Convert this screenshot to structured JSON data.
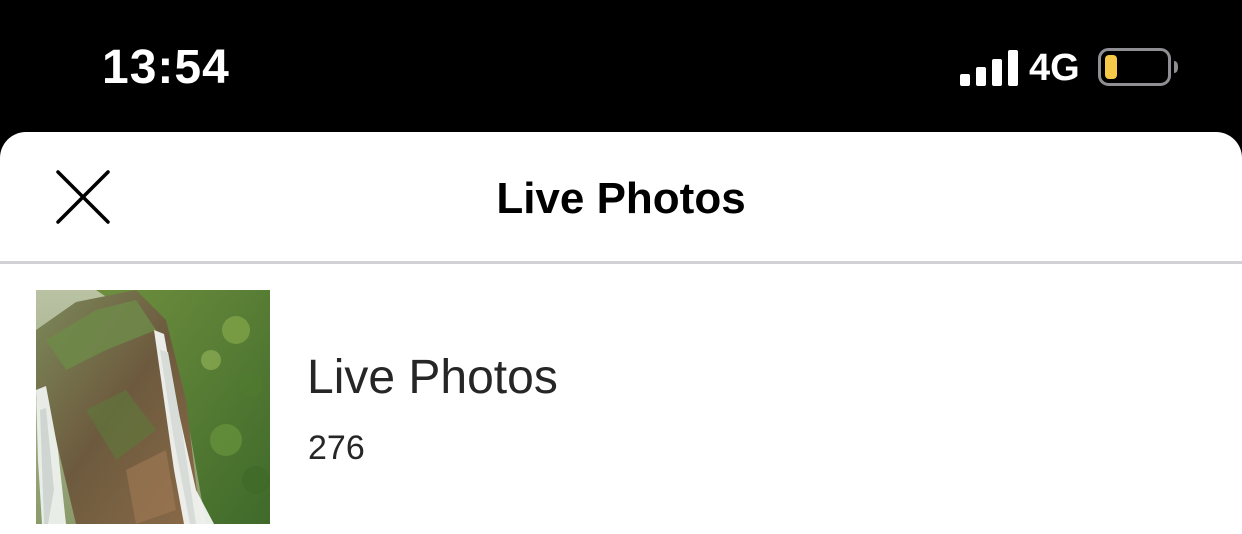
{
  "status_bar": {
    "time": "13:54",
    "network": "4G",
    "signal_bars": 4,
    "battery_level": 0.2,
    "battery_color": "#f7c948"
  },
  "header": {
    "title": "Live Photos",
    "close_icon": "close-icon"
  },
  "albums": [
    {
      "name": "Live Photos",
      "count": "276",
      "thumbnail": "waterfall-photo"
    }
  ]
}
